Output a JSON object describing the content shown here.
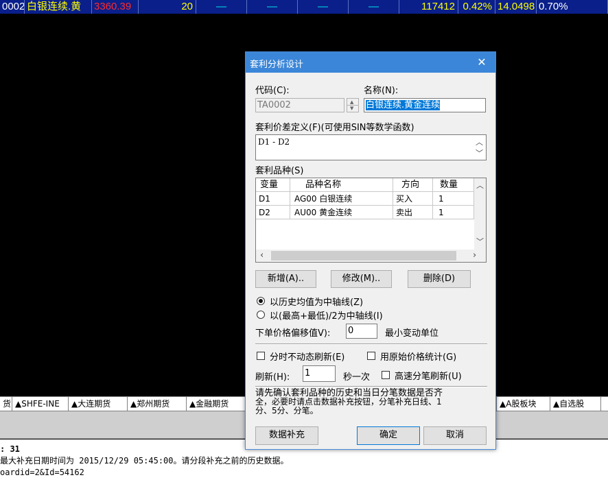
{
  "quote_row": [
    {
      "text": "0002",
      "color": "#ffffff",
      "w": 36
    },
    {
      "text": "白银连续.黄",
      "color": "#ffff00",
      "w": 98
    },
    {
      "text": "3360.39",
      "color": "#ff2a2a",
      "w": 68
    },
    {
      "text": "20",
      "color": "#ffff00",
      "w": 84,
      "align": "right"
    },
    {
      "text": "—",
      "color": "#00e5e5",
      "w": 74,
      "align": "center"
    },
    {
      "text": "—",
      "color": "#00e5e5",
      "w": 74,
      "align": "center"
    },
    {
      "text": "—",
      "color": "#00e5e5",
      "w": 74,
      "align": "center"
    },
    {
      "text": "—",
      "color": "#00e5e5",
      "w": 74,
      "align": "center"
    },
    {
      "text": "117412",
      "color": "#ffff00",
      "w": 86,
      "align": "right"
    },
    {
      "text": "0.42%",
      "color": "#ffff00",
      "w": 54,
      "align": "right"
    },
    {
      "text": "14.0498",
      "color": "#ffff00",
      "w": 60
    },
    {
      "text": "0.70%",
      "color": "#ffffff",
      "w": 104
    }
  ],
  "dialog": {
    "title": "套利分析设计",
    "close_glyph": "✕",
    "code_label": "代码(C):",
    "name_label": "名称(N):",
    "code_value": "TA0002",
    "name_value": "白银连续.黄金连续",
    "formula_label": "套利价差定义(F)(可使用SIN等数学函数)",
    "formula_value": "D1 - D2",
    "varieties_label": "套利品种(S)",
    "table": {
      "headers": [
        "变量",
        "品种名称",
        "方向",
        "数量"
      ],
      "rows": [
        [
          "D1",
          "AG00 白银连续",
          "买入",
          "1"
        ],
        [
          "D2",
          "AU00 黄金连续",
          "卖出",
          "1"
        ]
      ]
    },
    "btn_add": "新增(A)..",
    "btn_edit": "修改(M)..",
    "btn_delete": "删除(D)",
    "radio_hist": "以历史均值为中轴线(Z)",
    "radio_highlow": "以(最高+最低)/2为中轴线(I)",
    "offset_label": "下单价格偏移值V):",
    "offset_value": "0",
    "min_unit_label": "最小变动单位",
    "chk_no_dynamic": "分时不动态刷新(E)",
    "chk_raw_price": "用原始价格统计(G)",
    "refresh_label": "刷新(H):",
    "refresh_value": "1",
    "per_second_label": "秒一次",
    "chk_fast_refresh": "高速分笔刷新(U)",
    "notice_lines": [
      "请先确认套利品种的历史和当日分笔数据是否齐",
      "全，必要时请点击数据补充按钮，分笔补充日线、1",
      "分、5分、分笔。"
    ],
    "btn_supplement": "数据补充",
    "btn_ok": "确定",
    "btn_cancel": "取消"
  },
  "tabs": [
    {
      "text": "货",
      "w": 18
    },
    {
      "text": "▲SHFE-INE",
      "w": 82
    },
    {
      "text": "▲大连期货",
      "w": 86
    },
    {
      "text": "▲郑州期货",
      "w": 86
    },
    {
      "text": "▲金融期货",
      "w": 86
    },
    {
      "text": "",
      "w": 366
    },
    {
      "text": "▲A股板块",
      "w": 78
    },
    {
      "text": "▲自选股",
      "w": 74
    }
  ],
  "log_lines": [
    ": 31",
    "最大补充日期时间为 2015/12/29 05:45:00。请分段补充之前的历史数据。",
    "oardid=2&Id=54162"
  ]
}
